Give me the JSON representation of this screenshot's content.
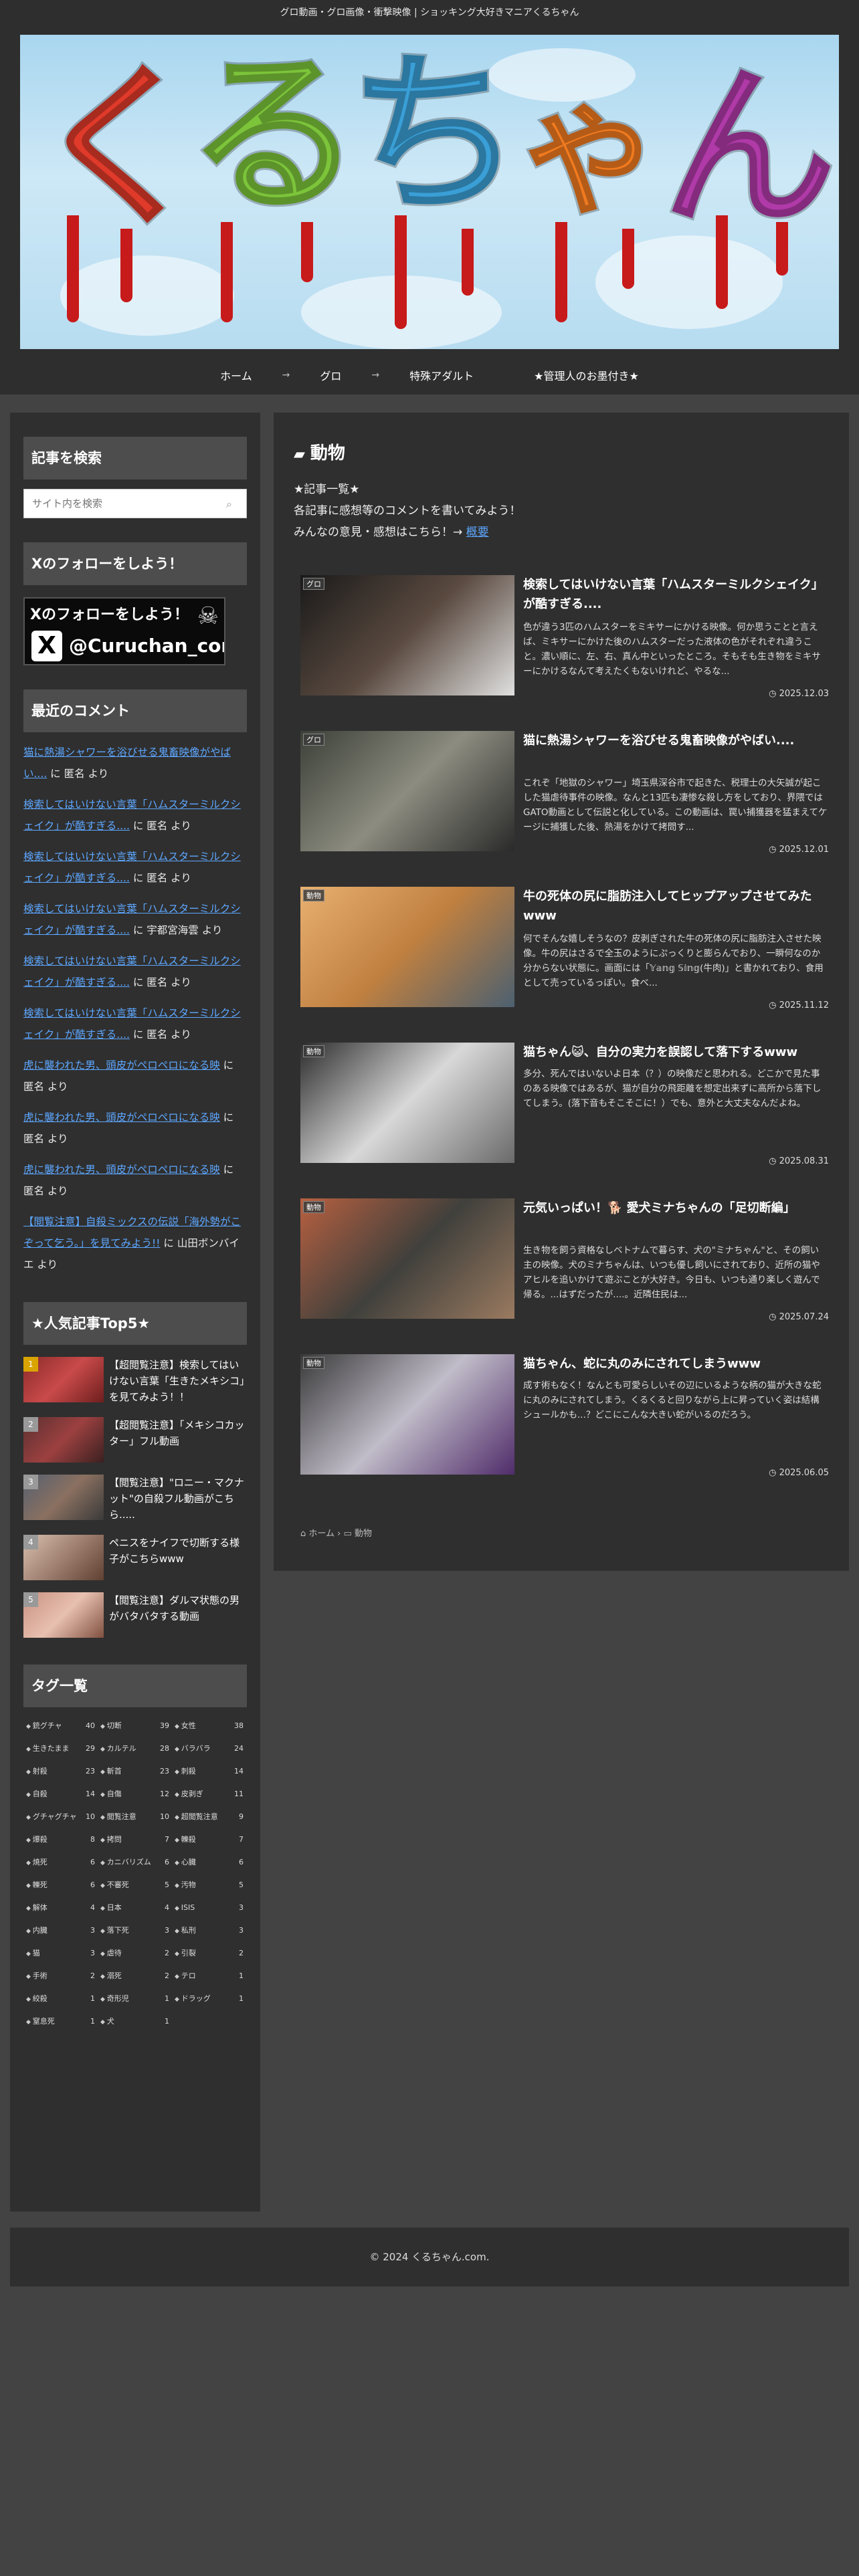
{
  "header": {
    "tagline": "グロ動画・グロ画像・衝撃映像 | ショッキング大好きマニアくるちゃん",
    "logo_text": [
      "く",
      "る",
      "ち",
      "ゃ",
      "ん"
    ],
    "logo_colors": [
      "#e03a2a",
      "#7cc43a",
      "#3a9fd6",
      "#f07a1f",
      "#b03aa8"
    ]
  },
  "nav": {
    "items": [
      "ホーム",
      "グロ",
      "特殊アダルト",
      "★管理人のお墨付き★"
    ],
    "separator": "→"
  },
  "sidebar": {
    "search_title": "記事を検索",
    "search_placeholder": "サイト内を検索",
    "follow_title": "Xのフォローをしよう！",
    "follow_banner_top": "Xのフォローをしよう！",
    "follow_banner_handle": "@Curuchan_com",
    "recent_title": "最近のコメント",
    "comments": [
      {
        "link": "猫に熱湯シャワーを浴びせる鬼畜映像がやばい....",
        "suffix": " に 匿名 より"
      },
      {
        "link": "検索してはいけない言葉「ハムスターミルクシェイク」が酷すぎる....",
        "suffix": " に 匿名 より"
      },
      {
        "link": "検索してはいけない言葉「ハムスターミルクシェイク」が酷すぎる....",
        "suffix": " に 匿名 より"
      },
      {
        "link": "検索してはいけない言葉「ハムスターミルクシェイク」が酷すぎる....",
        "suffix": " に 宇都宮海雲 より"
      },
      {
        "link": "検索してはいけない言葉「ハムスターミルクシェイク」が酷すぎる....",
        "suffix": " に 匿名 より"
      },
      {
        "link": "検索してはいけない言葉「ハムスターミルクシェイク」が酷すぎる....",
        "suffix": " に 匿名 より"
      },
      {
        "link": "虎に襲われた男、頭皮がペロペロになる映",
        "suffix": " に 匿名 より"
      },
      {
        "link": "虎に襲われた男、頭皮がペロペロになる映",
        "suffix": " に 匿名 より"
      },
      {
        "link": "虎に襲われた男、頭皮がペロペロになる映",
        "suffix": " に 匿名 より"
      },
      {
        "link": "【閲覧注意】自殺ミックスの伝説「海外勢がこぞって乞う。」を見てみよう!!",
        "suffix": " に 山田ボンバイエ より"
      }
    ],
    "popular_title": "★人気記事Top5★",
    "popular": [
      {
        "rank": "1",
        "title": "【超閲覧注意】検索してはいけない言葉「生きたメキシコ」を見てみよう！！"
      },
      {
        "rank": "2",
        "title": "【超閲覧注意】「メキシコカッター」フル動画"
      },
      {
        "rank": "3",
        "title": "【閲覧注意】\"ロニー・マクナット\"の自殺フル動画がこちら....."
      },
      {
        "rank": "4",
        "title": "ペニスをナイフで切断する様子がこちらwww"
      },
      {
        "rank": "5",
        "title": "【閲覧注意】ダルマ状態の男がバタバタする動画"
      }
    ],
    "tags_title": "タグ一覧",
    "tags": [
      {
        "name": "銃グチャ",
        "count": "40"
      },
      {
        "name": "切断",
        "count": "39"
      },
      {
        "name": "女性",
        "count": "38"
      },
      {
        "name": "生きたまま",
        "count": "29"
      },
      {
        "name": "カルテル",
        "count": "28"
      },
      {
        "name": "バラバラ",
        "count": "24"
      },
      {
        "name": "射殺",
        "count": "23"
      },
      {
        "name": "斬首",
        "count": "23"
      },
      {
        "name": "刺殺",
        "count": "14"
      },
      {
        "name": "自殺",
        "count": "14"
      },
      {
        "name": "自傷",
        "count": "12"
      },
      {
        "name": "皮剥ぎ",
        "count": "11"
      },
      {
        "name": "グチャグチャ",
        "count": "10"
      },
      {
        "name": "閲覧注意",
        "count": "10"
      },
      {
        "name": "超閲覧注意",
        "count": "9"
      },
      {
        "name": "爆殺",
        "count": "8"
      },
      {
        "name": "拷問",
        "count": "7"
      },
      {
        "name": "轢殺",
        "count": "7"
      },
      {
        "name": "焼死",
        "count": "6"
      },
      {
        "name": "カニバリズム",
        "count": "6"
      },
      {
        "name": "心臓",
        "count": "6"
      },
      {
        "name": "轢死",
        "count": "6"
      },
      {
        "name": "不審死",
        "count": "5"
      },
      {
        "name": "汚物",
        "count": "5"
      },
      {
        "name": "解体",
        "count": "4"
      },
      {
        "name": "日本",
        "count": "4"
      },
      {
        "name": "ISIS",
        "count": "3"
      },
      {
        "name": "内臓",
        "count": "3"
      },
      {
        "name": "落下死",
        "count": "3"
      },
      {
        "name": "私刑",
        "count": "3"
      },
      {
        "name": "猫",
        "count": "3"
      },
      {
        "name": "虐待",
        "count": "2"
      },
      {
        "name": "引裂",
        "count": "2"
      },
      {
        "name": "手術",
        "count": "2"
      },
      {
        "name": "溺死",
        "count": "2"
      },
      {
        "name": "テロ",
        "count": "1"
      },
      {
        "name": "絞殺",
        "count": "1"
      },
      {
        "name": "奇形児",
        "count": "1"
      },
      {
        "name": "ドラッグ",
        "count": "1"
      },
      {
        "name": "窒息死",
        "count": "1"
      },
      {
        "name": "犬",
        "count": "1"
      }
    ]
  },
  "main": {
    "category_title": "動物",
    "intro_line1": "★記事一覧★",
    "intro_line2": "各記事に感想等のコメントを書いてみよう！",
    "intro_line3": "みんなの意見・感想はこちら！→ ",
    "intro_link": "概要",
    "articles": [
      {
        "badge": "グロ",
        "title": "検索してはいけない言葉「ハムスターミルクシェイク」が酷すぎる....",
        "snippet": "色が違う3匹のハムスターをミキサーにかける映像。何か思うことと言えば、ミキサーにかけた後のハムスターだった液体の色がそれぞれ違うこと。濃い順に、左、右、真ん中といったところ。そもそも生き物をミキサーにかけるなんて考えたくもないけれど、やるな...",
        "date": "2025.12.03"
      },
      {
        "badge": "グロ",
        "title": "猫に熱湯シャワーを浴びせる鬼畜映像がやばい....",
        "snippet": "これぞ「地獄のシャワー」埼玉県深谷市で起きた、税理士の大矢誠が起こした猫虐待事件の映像。なんと13匹も凄惨な殺し方をしており、界隈ではGATO動画として伝説と化している。この動画は、罠い捕獲器を猛まえてケージに捕獲した後、熱湯をかけて拷問す...",
        "date": "2025.12.01"
      },
      {
        "badge": "動物",
        "title": "牛の死体の尻に脂肪注入してヒップアップさせてみたwww",
        "snippet": "何でそんな嬉しそうなの？皮剥ぎされた牛の死体の尻に脂肪注入させた映像。牛の尻はさるで全玉のようにぷっくりと膨らんでおり、一瞬何なのか分からない状態に。画面には「𝕐𝕒𝕟𝕘 𝕊𝕚𝕟𝕘(牛肉)」と書かれており、食用として売っているっぽい。食べ...",
        "date": "2025.11.12"
      },
      {
        "badge": "動物",
        "title": "猫ちゃん😺、自分の実力を誤認して落下するwww",
        "snippet": "多分、死んではいないよ日本（？）の映像だと思われる。どこかで見た事のある映像ではあるが、猫が自分の飛距離を想定出来ずに高所から落下してしまう。(落下音もそこそこに！）でも、意外と大丈夫なんだよね。",
        "date": "2025.08.31"
      },
      {
        "badge": "動物",
        "title": "元気いっぱい！🐕 愛犬ミナちゃんの「足切断編」",
        "snippet": "生き物を飼う資格なしベトナムで暮らす、犬の\"ミナちゃん\"と、その飼い主の映像。犬のミナちゃんは、いつも優し飼いにされており、近所の猫やアヒルを追いかけて遊ぶことが大好き。今日も、いつも通り楽しく遊んで帰る。...はずだったが....。近隣住民は...",
        "date": "2025.07.24"
      },
      {
        "badge": "動物",
        "title": "猫ちゃん、蛇に丸のみにされてしまうwww",
        "snippet": "成す術もなく！なんとも可愛らしいその辺にいるような柄の猫が大きな蛇に丸のみにされてしまう。くるくると回りながら上に昇っていく姿は結構シュールかも...？どこにこんな大きい蛇がいるのだろう。",
        "date": "2025.06.05"
      }
    ],
    "breadcrumb_home": "ホーム",
    "breadcrumb_current": "動物"
  },
  "footer": {
    "copyright": "© 2024 くるちゃん.com."
  }
}
